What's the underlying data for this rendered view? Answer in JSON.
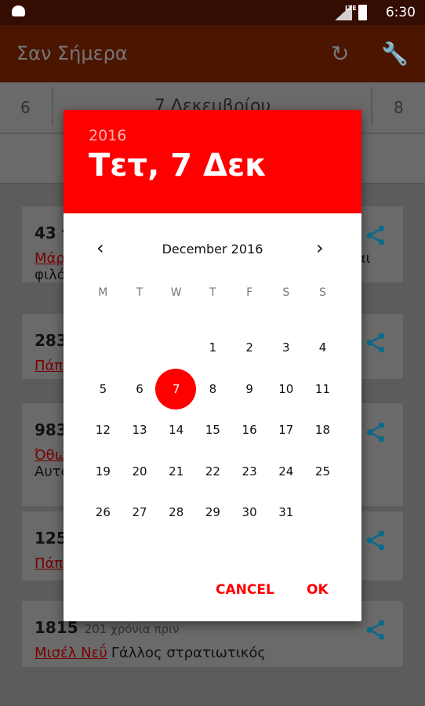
{
  "status_bar": {
    "time": "6:30",
    "network": "LTE"
  },
  "app_bar": {
    "title": "Σαν Σήμερα",
    "icons": [
      "refresh-icon",
      "wrench-icon"
    ]
  },
  "date_nav": {
    "prev": "6",
    "current": "7 Δεκεμβρίου",
    "next": "8"
  },
  "cards": [
    {
      "year": "43 τ",
      "ago": "",
      "link": "Μάρ",
      "text": "και",
      "line2": "φιλό"
    },
    {
      "year": "283",
      "ago": "",
      "link": "Πάπ",
      "text": "",
      "line2": ""
    },
    {
      "year": "983",
      "ago": "",
      "link": "Όθω",
      "text": "",
      "line2": "Αυτο"
    },
    {
      "year": "125",
      "ago": "",
      "link": "Πάπ",
      "text": "",
      "line2": ""
    },
    {
      "year": "1815",
      "ago": "201 χρόνια πριν",
      "link": "Μισέλ Νεΰ",
      "text": "Γάλλος στρατιωτικός",
      "line2": ""
    }
  ],
  "dialog": {
    "year": "2016",
    "date": "Τετ, 7 Δεκ",
    "month": "December 2016",
    "weekdays": [
      "M",
      "T",
      "W",
      "T",
      "F",
      "S",
      "S"
    ],
    "weeks": [
      [
        "",
        "",
        "",
        "1",
        "2",
        "3",
        "4"
      ],
      [
        "5",
        "6",
        "7",
        "8",
        "9",
        "10",
        "11"
      ],
      [
        "12",
        "13",
        "14",
        "15",
        "16",
        "17",
        "18"
      ],
      [
        "19",
        "20",
        "21",
        "22",
        "23",
        "24",
        "25"
      ],
      [
        "26",
        "27",
        "28",
        "29",
        "30",
        "31",
        ""
      ]
    ],
    "selected": "7",
    "cancel": "CANCEL",
    "ok": "OK",
    "accent": "#ff0000"
  }
}
